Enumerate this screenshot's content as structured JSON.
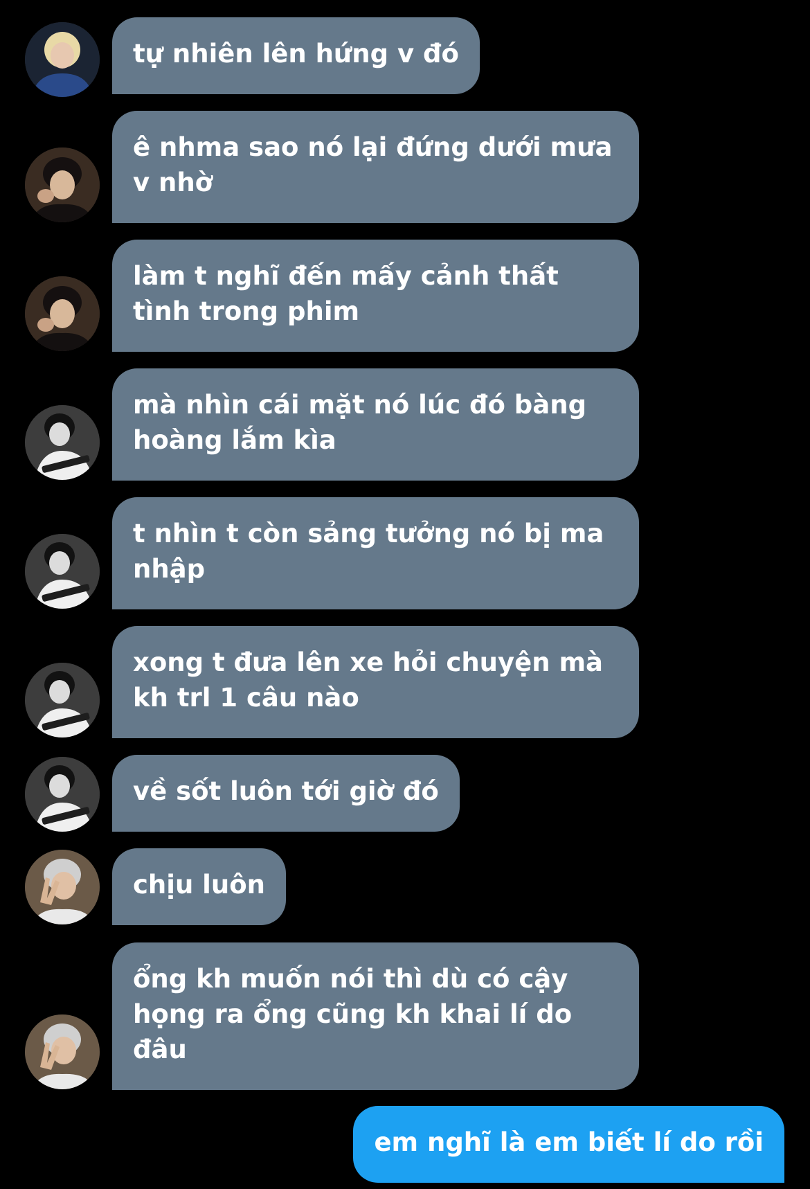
{
  "messages": [
    {
      "direction": "incoming",
      "avatar": "avatar-blond",
      "text": "tự nhiên lên hứng v đó"
    },
    {
      "direction": "incoming",
      "avatar": "avatar-dark-hair",
      "text": "ê nhma sao nó lại đứng dưới mưa v nhờ"
    },
    {
      "direction": "incoming",
      "avatar": "avatar-dark-hair",
      "text": "làm t nghĩ đến mấy cảnh thất tình trong phim"
    },
    {
      "direction": "incoming",
      "avatar": "avatar-guitar",
      "text": "mà nhìn cái mặt nó lúc đó bàng hoàng lắm kìa"
    },
    {
      "direction": "incoming",
      "avatar": "avatar-guitar",
      "text": "t nhìn t còn sảng tưởng nó bị ma nhập"
    },
    {
      "direction": "incoming",
      "avatar": "avatar-guitar",
      "text": "xong t đưa lên xe hỏi chuyện mà kh trl 1 câu nào"
    },
    {
      "direction": "incoming",
      "avatar": "avatar-guitar",
      "text": "về sốt luôn tới giờ đó"
    },
    {
      "direction": "incoming",
      "avatar": "avatar-peace-sign",
      "text": "chịu luôn"
    },
    {
      "direction": "incoming",
      "avatar": "avatar-peace-sign",
      "text": "ổng kh muốn nói thì dù có cậy họng ra ổng cũng kh khai lí do đâu"
    },
    {
      "direction": "outgoing",
      "text": "em nghĩ là em biết lí do rồi"
    }
  ]
}
